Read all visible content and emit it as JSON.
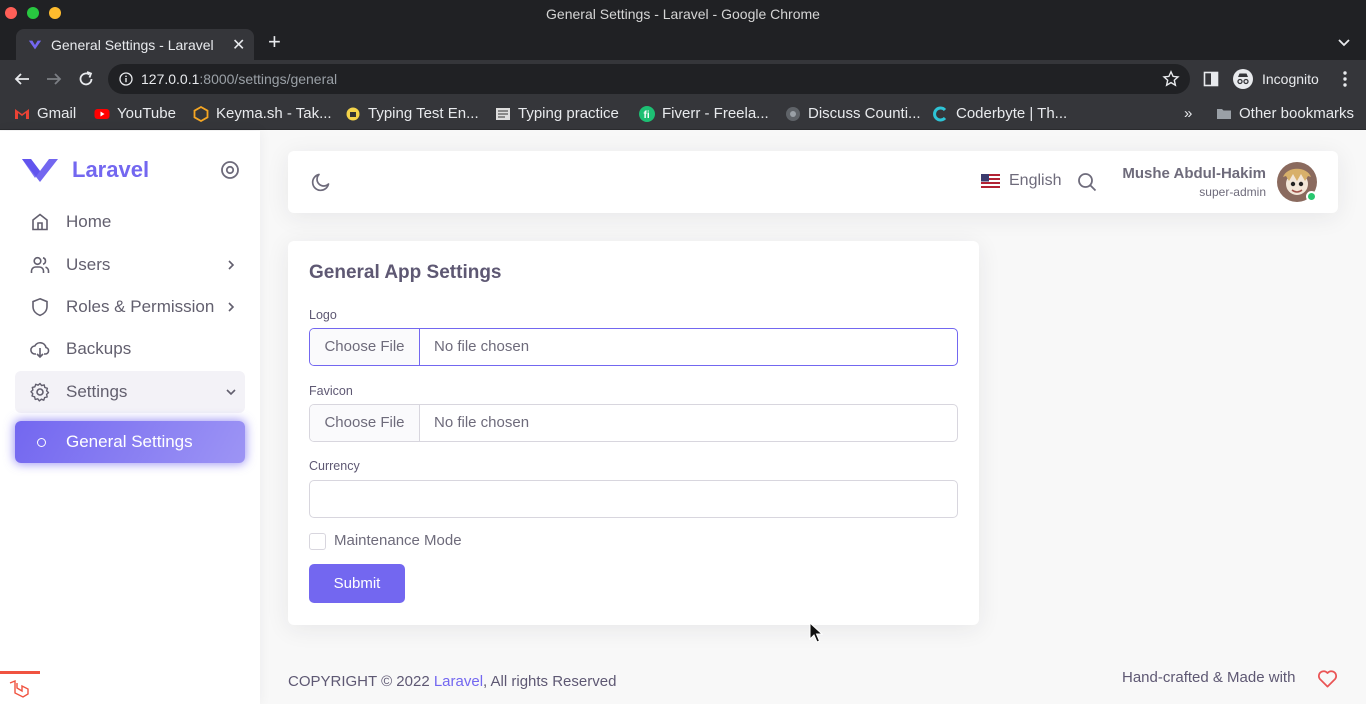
{
  "window": {
    "title": "General Settings - Laravel - Google Chrome"
  },
  "browser": {
    "tab_title": "General Settings - Laravel",
    "url_host": "127.0.0.1",
    "url_rest": ":8000/settings/general",
    "profile_label": "Incognito",
    "bookmarks": [
      {
        "label": "Gmail",
        "icon": "gmail-icon"
      },
      {
        "label": "YouTube",
        "icon": "youtube-icon"
      },
      {
        "label": "Keyma.sh - Tak...",
        "icon": "keymash-icon"
      },
      {
        "label": "Typing Test En...",
        "icon": "typingtest-icon"
      },
      {
        "label": "Typing practice",
        "icon": "typing-practice-icon"
      },
      {
        "label": "Fiverr - Freela...",
        "icon": "fiverr-icon"
      },
      {
        "label": "Discuss Counti...",
        "icon": "globe-icon"
      },
      {
        "label": "Coderbyte | Th...",
        "icon": "coderbyte-icon"
      }
    ],
    "other_bookmarks": "Other bookmarks"
  },
  "sidebar": {
    "brand": "Laravel",
    "items": [
      {
        "label": "Home",
        "icon": "home-icon"
      },
      {
        "label": "Users",
        "icon": "users-icon"
      },
      {
        "label": "Roles & Permission",
        "icon": "shield-icon"
      },
      {
        "label": "Backups",
        "icon": "download-cloud-icon"
      },
      {
        "label": "Settings",
        "icon": "gear-icon"
      },
      {
        "label": "General Settings",
        "icon": "circle-icon"
      }
    ]
  },
  "navbar": {
    "language": "English",
    "user_name": "Mushe Abdul-Hakim",
    "user_role": "super-admin"
  },
  "form": {
    "title": "General App Settings",
    "logo_label": "Logo",
    "favicon_label": "Favicon",
    "currency_label": "Currency",
    "choose_file": "Choose File",
    "no_file": "No file chosen",
    "currency_value": "",
    "maintenance_label": "Maintenance Mode",
    "maintenance_checked": false,
    "submit_label": "Submit"
  },
  "footer": {
    "copyright_prefix": "COPYRIGHT © 2022 ",
    "brand_link": "Laravel",
    "copyright_suffix": ", All rights Reserved",
    "crafted": "Hand-crafted & Made with"
  },
  "colors": {
    "primary": "#7367f0",
    "online": "#28c76f",
    "danger": "#ea5455"
  }
}
